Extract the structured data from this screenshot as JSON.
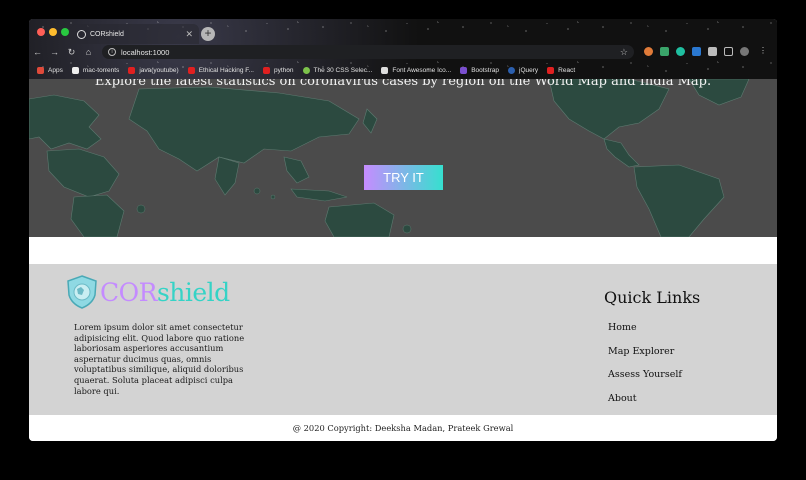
{
  "browser": {
    "tab_title": "CORshield",
    "url": "localhost:1000",
    "bookmarks": [
      {
        "label": "Apps",
        "color": "#e04a3a"
      },
      {
        "label": "mac-torrents",
        "color": "#eeeeee"
      },
      {
        "label": "java(youtube)",
        "color": "#e02020"
      },
      {
        "label": "Ethical Hacking F...",
        "color": "#e02020"
      },
      {
        "label": "python",
        "color": "#e02020"
      },
      {
        "label": "The 30 CSS Selec...",
        "color": "#7cc24b"
      },
      {
        "label": "Font Awesome Ico...",
        "color": "#dddddd"
      },
      {
        "label": "Bootstrap",
        "color": "#7a4fcf"
      },
      {
        "label": "jQuery",
        "color": "#2b5fae"
      },
      {
        "label": "React",
        "color": "#e02020"
      }
    ]
  },
  "hero": {
    "tagline": "Explore the latest statistics on coronavirus cases by region on the World Map and India Map.",
    "cta_label": "TRY IT"
  },
  "footer": {
    "brand_part1": "COR",
    "brand_part2": "shield",
    "about": "Lorem ipsum dolor sit amet consectetur adipisicing elit. Quod labore quo ratione laboriosam asperiores accusantium aspernatur ducimus quas, omnis voluptatibus similique, aliquid doloribus quaerat. Soluta placeat adipisci culpa labore qui.",
    "quick_links_title": "Quick Links",
    "links": [
      "Home",
      "Map Explorer",
      "Assess Yourself",
      "About"
    ],
    "copyright": "@ 2020 Copyright: Deeksha Madan, Prateek Grewal"
  },
  "colors": {
    "brand_purple": "#c48bff",
    "brand_teal": "#35d3c6",
    "map_land": "#2c4a40",
    "footer_bg": "#d3d3d3"
  }
}
